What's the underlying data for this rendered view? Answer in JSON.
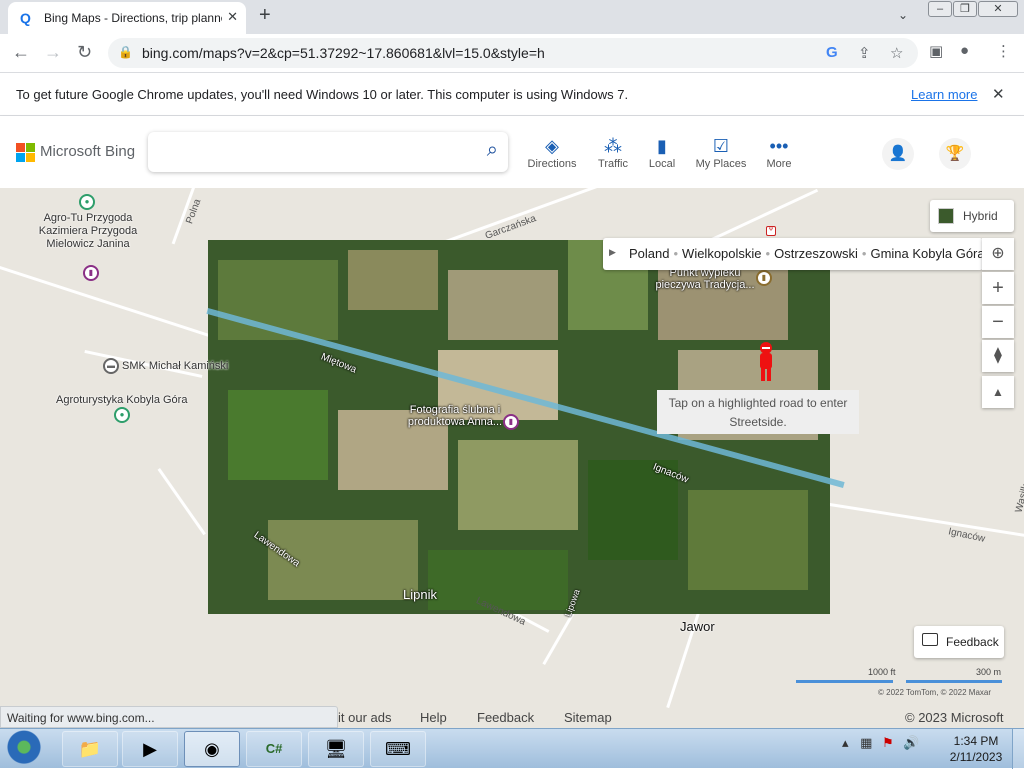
{
  "browser": {
    "tab_title": "Bing Maps - Directions, trip planner",
    "tab_icon": "search-icon",
    "url": "bing.com/maps?v=2&cp=51.37292~17.860681&lvl=15.0&style=h"
  },
  "infobar": {
    "message": "To get future Google Chrome updates, you'll need Windows 10 or later. This computer is using Windows 7.",
    "learn_more": "Learn more"
  },
  "bing": {
    "logo_text": "Microsoft Bing",
    "search_placeholder": "",
    "nav": [
      {
        "label": "Directions",
        "icon": "directions-icon"
      },
      {
        "label": "Traffic",
        "icon": "traffic-icon"
      },
      {
        "label": "Local",
        "icon": "local-icon"
      },
      {
        "label": "My Places",
        "icon": "my-places-icon"
      },
      {
        "label": "More",
        "icon": "more-icon"
      }
    ]
  },
  "map": {
    "style_label": "Hybrid",
    "breadcrumb": [
      "Poland",
      "Wielkopolskie",
      "Ostrzeszowski",
      "Gmina Kobyla Góra"
    ],
    "tooltip_line1": "Tap on a highlighted road to enter",
    "tooltip_line2": "Streetside.",
    "labels": {
      "agro": "Agro-Tu Przygoda Kazimiera Przygoda Mielowicz Janina",
      "smk": "SMK Michał Kamiński",
      "agroturystyka": "Agroturystyka Kobyla Góra",
      "fotografia": "Fotografia ślubna i produktowa Anna...",
      "punkt": "Punkt wypieku pieczywa Tradycja...",
      "lipnik": "Lipnik",
      "jawor": "Jawor"
    },
    "road_labels": {
      "mietowa": "Miętowa",
      "ignacow": "Ignaców",
      "ignacow2": "Ignaców",
      "lawendowa": "Lawendowa",
      "lawendowa2": "Lawendowa",
      "gorcza": "Garczańska",
      "polna": "Polna",
      "lipowa": "Lipowa",
      "wasilk": "Wasilk"
    },
    "feedback": "Feedback",
    "scale_ft": "1000 ft",
    "scale_m": "300 m",
    "copyright": "© 2022 TomTom, © 2022 Maxar"
  },
  "footer": {
    "links": [
      "it our ads",
      "Help",
      "Feedback",
      "Sitemap"
    ],
    "copyright": "© 2023 Microsoft"
  },
  "status": "Waiting for www.bing.com...",
  "taskbar": {
    "time": "1:34 PM",
    "date": "2/11/2023"
  }
}
